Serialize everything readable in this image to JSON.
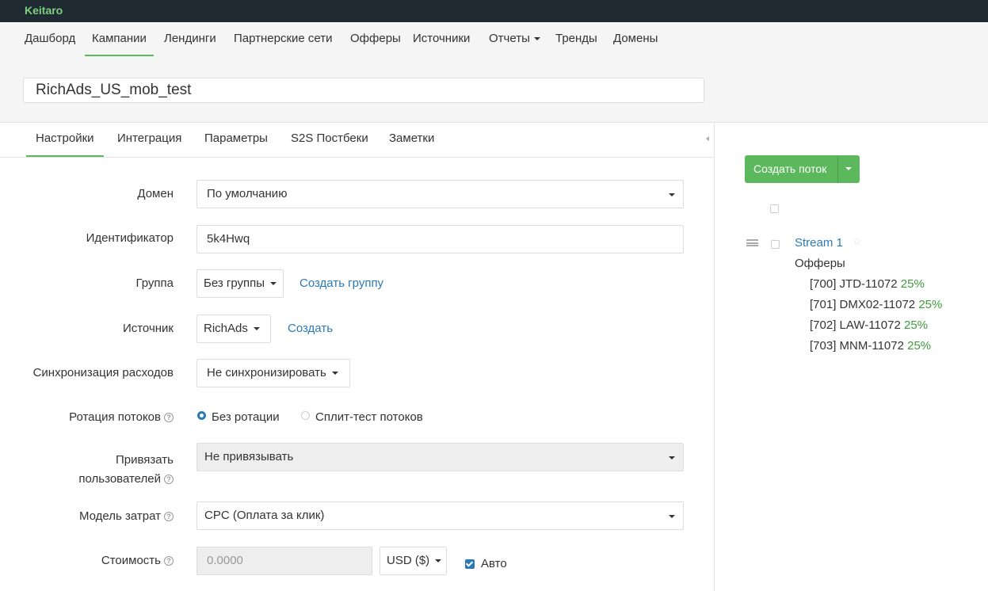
{
  "brand": "Keitaro",
  "nav": [
    "Дашборд",
    "Кампании",
    "Лендинги",
    "Партнерские сети",
    "Офферы",
    "Источники",
    "Отчеты",
    "Тренды",
    "Домены"
  ],
  "campaign_name": "RichAds_US_mob_test",
  "subtabs": [
    "Настройки",
    "Интеграция",
    "Параметры",
    "S2S Постбеки",
    "Заметки"
  ],
  "form": {
    "domain_label": "Домен",
    "domain_value": "По умолчанию",
    "id_label": "Идентификатор",
    "id_value": "5k4Hwq",
    "group_label": "Группа",
    "group_value": "Без группы",
    "group_link": "Создать группу",
    "source_label": "Источник",
    "source_value": "RichAds",
    "source_link": "Создать",
    "sync_label": "Синхронизация расходов",
    "sync_value": "Не синхронизировать",
    "rotation_label": "Ротация потоков",
    "rotation_opt1": "Без ротации",
    "rotation_opt2": "Сплит-тест потоков",
    "bind_label_1": "Привязать",
    "bind_label_2": "пользователей",
    "bind_value": "Не привязывать",
    "cost_model_label": "Модель затрат",
    "cost_model_value": "CPC (Оплата за клик)",
    "cost_label": "Стоимость",
    "cost_value": "0.0000",
    "currency": "USD ($)",
    "auto_label": "Авто"
  },
  "streams_panel": {
    "create_button": "Создать поток",
    "stream_name": "Stream 1",
    "offers_title": "Офферы",
    "offers": [
      {
        "name": "[700] JTD-11072",
        "share": "25%"
      },
      {
        "name": "[701] DMX02-11072",
        "share": "25%"
      },
      {
        "name": "[702] LAW-11072",
        "share": "25%"
      },
      {
        "name": "[703] MNM-11072",
        "share": "25%"
      }
    ]
  },
  "colors": {
    "accent": "#5cb85c",
    "link": "#2a7ab8",
    "topbar": "#1f2a33"
  }
}
